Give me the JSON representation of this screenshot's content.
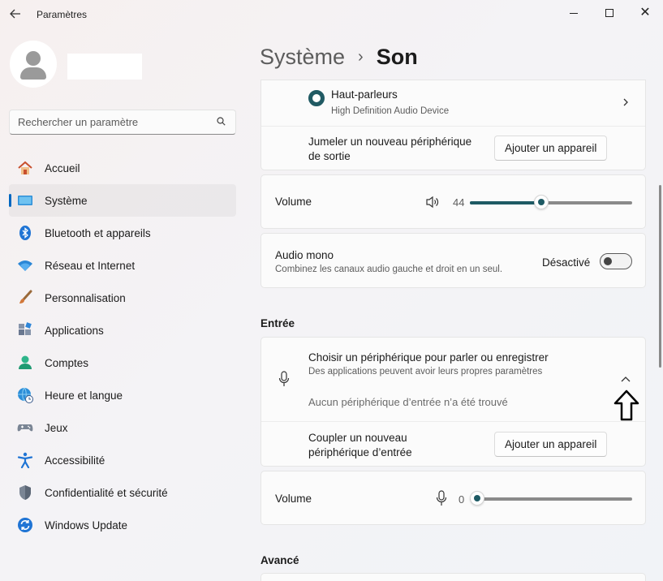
{
  "window": {
    "title": "Paramètres",
    "back_icon": "arrow-left-icon",
    "controls": [
      "minimize-icon",
      "maximize-icon",
      "close-icon"
    ]
  },
  "profile": {
    "avatar_icon": "user-avatar-icon",
    "name": ""
  },
  "search": {
    "placeholder": "Rechercher un paramètre",
    "value": "",
    "icon": "search-icon"
  },
  "sidebar": {
    "items": [
      {
        "label": "Accueil",
        "icon": "home-icon",
        "active": false
      },
      {
        "label": "Système",
        "icon": "system-display-icon",
        "active": true
      },
      {
        "label": "Bluetooth et appareils",
        "icon": "bluetooth-icon",
        "active": false
      },
      {
        "label": "Réseau et Internet",
        "icon": "wifi-icon",
        "active": false
      },
      {
        "label": "Personnalisation",
        "icon": "brush-icon",
        "active": false
      },
      {
        "label": "Applications",
        "icon": "apps-icon",
        "active": false
      },
      {
        "label": "Comptes",
        "icon": "account-icon",
        "active": false
      },
      {
        "label": "Heure et langue",
        "icon": "globe-clock-icon",
        "active": false
      },
      {
        "label": "Jeux",
        "icon": "gamepad-icon",
        "active": false
      },
      {
        "label": "Accessibilité",
        "icon": "accessibility-icon",
        "active": false
      },
      {
        "label": "Confidentialité et sécurité",
        "icon": "shield-icon",
        "active": false
      },
      {
        "label": "Windows Update",
        "icon": "update-icon",
        "active": false
      }
    ]
  },
  "breadcrumb": {
    "parent": "Système",
    "separator": "›",
    "current": "Son"
  },
  "output": {
    "device_name": "Haut-parleurs",
    "device_desc": "High Definition Audio Device",
    "pair_label_line1": "Jumeler un nouveau périphérique",
    "pair_label_line2": "de sortie",
    "pair_button": "Ajouter un appareil",
    "volume_label": "Volume",
    "volume_value": "44",
    "volume_fraction": 0.44,
    "mono_title": "Audio mono",
    "mono_desc": "Combinez les canaux audio gauche et droit en un seul.",
    "mono_state": "Désactivé"
  },
  "input": {
    "section_title": "Entrée",
    "choose_title": "Choisir un périphérique pour parler ou enregistrer",
    "choose_desc": "Des applications peuvent avoir leurs propres paramètres",
    "no_device": "Aucun périphérique d’entrée n’a été trouvé",
    "pair_label_line1": "Coupler un nouveau",
    "pair_label_line2": "périphérique d’entrée",
    "pair_button": "Ajouter un appareil",
    "volume_label": "Volume",
    "volume_value": "0",
    "volume_fraction": 0.0
  },
  "advanced": {
    "section_title": "Avancé"
  },
  "colors": {
    "accent": "#1e5a64",
    "nav_indicator": "#0067c0"
  }
}
